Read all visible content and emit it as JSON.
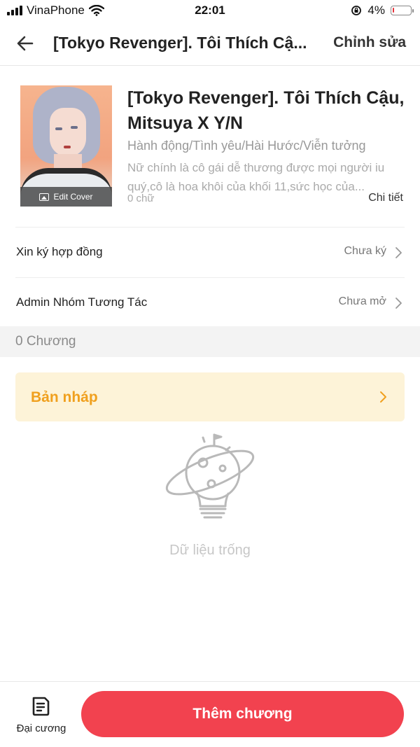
{
  "status_bar": {
    "carrier": "VinaPhone",
    "time": "22:01",
    "battery": "4%",
    "battery_level": 0.04
  },
  "header": {
    "title": "[Tokyo Revenger]. Tôi Thích Cậ...",
    "edit_label": "Chỉnh sửa"
  },
  "book": {
    "edit_cover_label": "Edit Cover",
    "title": "[Tokyo Revenger]. Tôi Thích Cậu, Mitsuya X Y/N",
    "genres": "Hành động/Tình yêu/Hài Hước/Viễn tưởng",
    "synopsis": "Nữ chính là cô gái dễ thương được mọi người iu quý,cô là hoa khôi của khối 11,sức học của...",
    "word_count": "0 chữ",
    "details_label": "Chi tiết"
  },
  "settings": [
    {
      "label": "Xin ký hợp đồng",
      "value": "Chưa ký"
    },
    {
      "label": "Admin Nhóm Tương Tác",
      "value": "Chưa mở"
    }
  ],
  "chapters": {
    "count_label": "0 Chương",
    "draft_label": "Bản nháp",
    "empty_text": "Dữ liệu trống"
  },
  "bottom": {
    "outline_label": "Đại cương",
    "add_chapter_label": "Thêm chương"
  },
  "colors": {
    "accent_red": "#f2424f",
    "draft_text": "#f0a01e",
    "draft_bg": "#fdf3d8"
  }
}
